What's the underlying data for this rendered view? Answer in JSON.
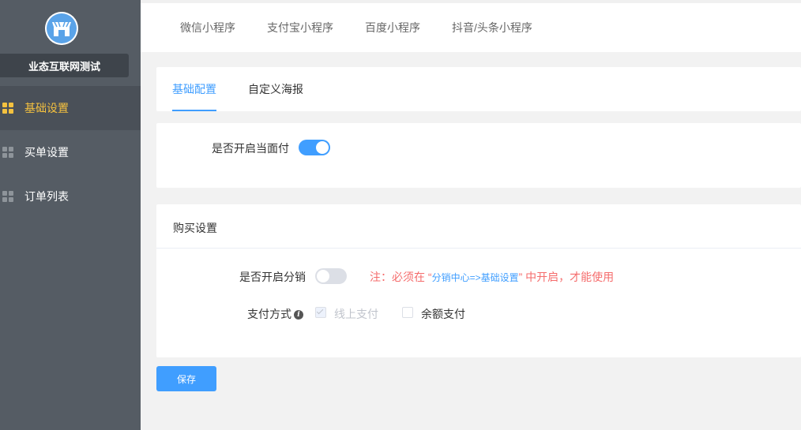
{
  "sidebar": {
    "shop_name": "业态互联网测试",
    "items": [
      {
        "label": "基础设置",
        "active": true
      },
      {
        "label": "买单设置",
        "active": false
      },
      {
        "label": "订单列表",
        "active": false
      }
    ]
  },
  "top_tabs": [
    "微信小程序",
    "支付宝小程序",
    "百度小程序",
    "抖音/头条小程序"
  ],
  "sub_tabs": [
    {
      "label": "基础配置",
      "active": true
    },
    {
      "label": "自定义海报",
      "active": false
    }
  ],
  "face_pay": {
    "label": "是否开启当面付",
    "enabled": true
  },
  "purchase": {
    "title": "购买设置",
    "distribution_label": "是否开启分销",
    "distribution_enabled": false,
    "note_prefix": "注：必须在 “",
    "note_link": "分销中心=>基础设置",
    "note_suffix": "” 中开启，才能使用",
    "payment_label": "支付方式",
    "options": [
      {
        "label": "线上支付",
        "checked": true,
        "disabled": true
      },
      {
        "label": "余额支付",
        "checked": false,
        "disabled": false
      }
    ]
  },
  "save_label": "保存",
  "colors": {
    "accent": "#409eff",
    "sidebar": "#555c64",
    "active_menu": "#f4c13f",
    "warning": "#f56c6c"
  }
}
